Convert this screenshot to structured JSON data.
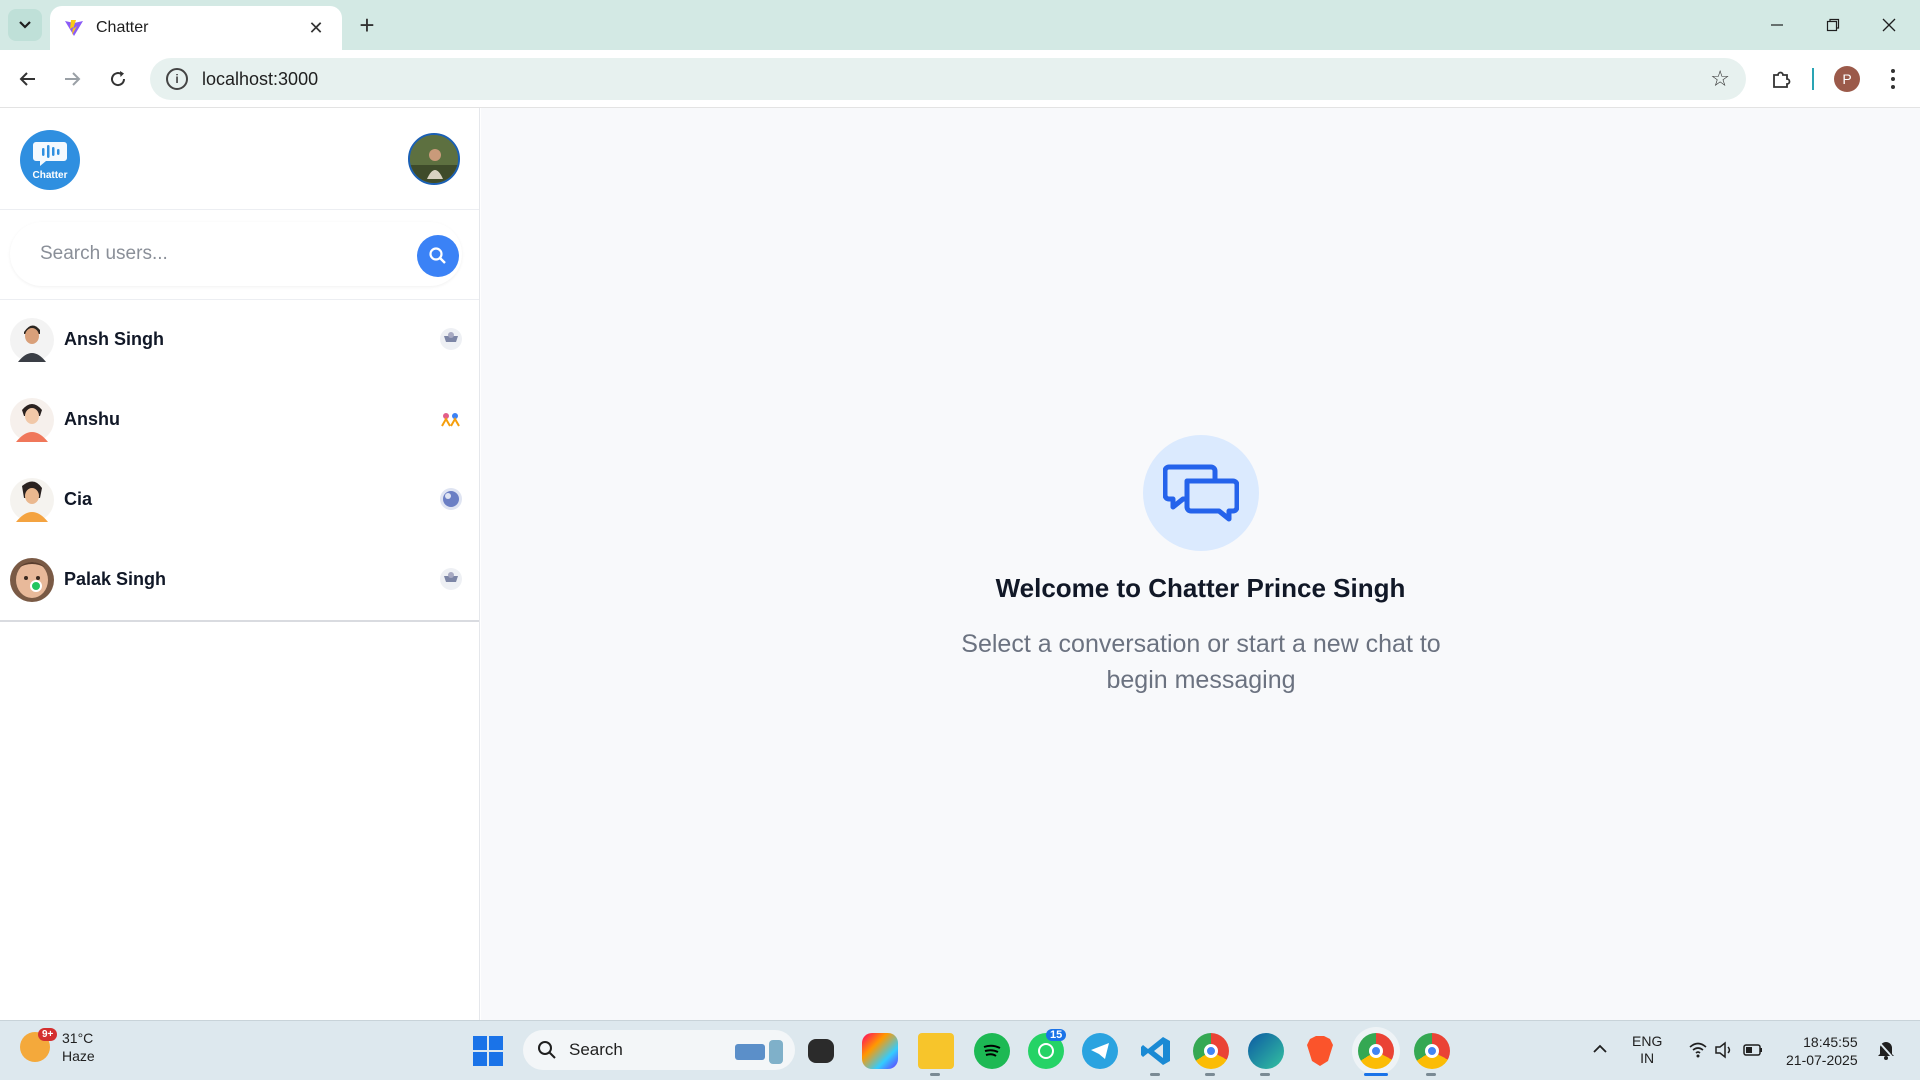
{
  "browser": {
    "tab_title": "Chatter",
    "url": "localhost:3000",
    "profile_initial": "P"
  },
  "app": {
    "logo_text": "Chatter",
    "search": {
      "placeholder": "Search users..."
    },
    "users": [
      {
        "name": "Ansh Singh",
        "online": false
      },
      {
        "name": "Anshu",
        "online": false
      },
      {
        "name": "Cia",
        "online": false
      },
      {
        "name": "Palak Singh",
        "online": true
      }
    ],
    "welcome": {
      "title": "Welcome to Chatter Prince Singh",
      "subtitle": "Select a conversation or start a new chat to begin messaging"
    }
  },
  "taskbar": {
    "weather_temp": "31°C",
    "weather_desc": "Haze",
    "weather_badge": "9+",
    "search_label": "Search",
    "whatsapp_badge": "15",
    "lang_line1": "ENG",
    "lang_line2": "IN",
    "time": "18:45:55",
    "date": "21-07-2025"
  },
  "colors": {
    "accent": "#3b82f6",
    "online": "#22c55e",
    "tabbar": "#d3e9e4"
  }
}
